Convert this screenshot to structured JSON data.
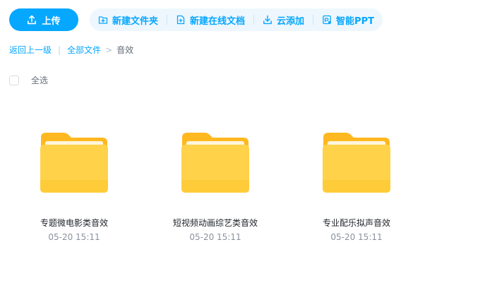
{
  "toolbar": {
    "upload_label": "上传",
    "actions": [
      {
        "label": "新建文件夹",
        "icon": "new-folder-icon"
      },
      {
        "label": "新建在线文档",
        "icon": "new-doc-icon"
      },
      {
        "label": "云添加",
        "icon": "cloud-download-icon"
      },
      {
        "label": "智能PPT",
        "icon": "smart-ppt-icon"
      }
    ]
  },
  "breadcrumb": {
    "back_label": "返回上一级",
    "all_files_label": "全部文件",
    "current": "音效"
  },
  "select_all_label": "全选",
  "folders": [
    {
      "name": "专题微电影类音效",
      "time": "05-20 15:11"
    },
    {
      "name": "短视频动画综艺类音效",
      "time": "05-20 15:11"
    },
    {
      "name": "专业配乐拟声音效",
      "time": "05-20 15:11"
    }
  ],
  "colors": {
    "accent": "#06a7ff",
    "action_bg": "#eef7fe",
    "folder_back": "#ffb81f",
    "folder_front": "#ffd24a"
  }
}
